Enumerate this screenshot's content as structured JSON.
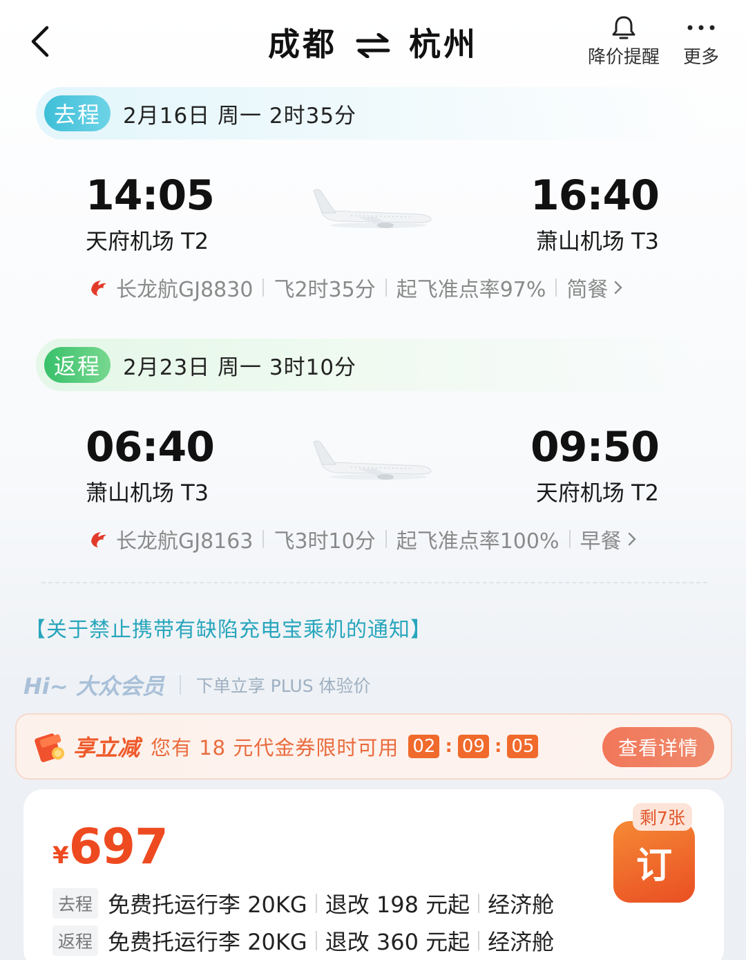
{
  "header": {
    "origin": "成都",
    "destination": "杭州",
    "alert_label": "降价提醒",
    "more_label": "更多"
  },
  "outbound": {
    "tag": "去程",
    "info": "2月16日 周一  2时35分",
    "dep_time": "14:05",
    "dep_airport": "天府机场 T2",
    "arr_time": "16:40",
    "arr_airport": "萧山机场 T3",
    "flight": "长龙航GJ8830",
    "duration": "飞2时35分",
    "ontime": "起飞准点率97%",
    "meal": "简餐"
  },
  "return": {
    "tag": "返程",
    "info": "2月23日 周一  3时10分",
    "dep_time": "06:40",
    "dep_airport": "萧山机场 T3",
    "arr_time": "09:50",
    "arr_airport": "天府机场 T2",
    "flight": "长龙航GJ8163",
    "duration": "飞3时10分",
    "ontime": "起飞准点率100%",
    "meal": "早餐"
  },
  "notice": "【关于禁止携带有缺陷充电宝乘机的通知】",
  "member": {
    "title": "Hi~ 大众会员",
    "subtitle": "下单立享 PLUS 体验价"
  },
  "coupon": {
    "name": "享立减",
    "text": "您有 18 元代金券限时可用",
    "timer_h": "02",
    "timer_m": "09",
    "timer_s": "05",
    "button": "查看详情"
  },
  "offer": {
    "currency": "¥",
    "price": "697",
    "remaining": "剩7张",
    "book_label": "订",
    "out_tag": "去程",
    "out_baggage": "免费托运行李 20KG",
    "out_change": "退改 198 元起",
    "out_cabin": "经济舱",
    "ret_tag": "返程",
    "ret_baggage": "免费托运行李 20KG",
    "ret_change": "退改 360 元起",
    "ret_cabin": "经济舱"
  },
  "colors": {
    "accent_orange": "#ee4a20",
    "outbound_pill": "#3fbfd8",
    "return_pill": "#38c06a",
    "notice_teal": "#28a6bc"
  }
}
